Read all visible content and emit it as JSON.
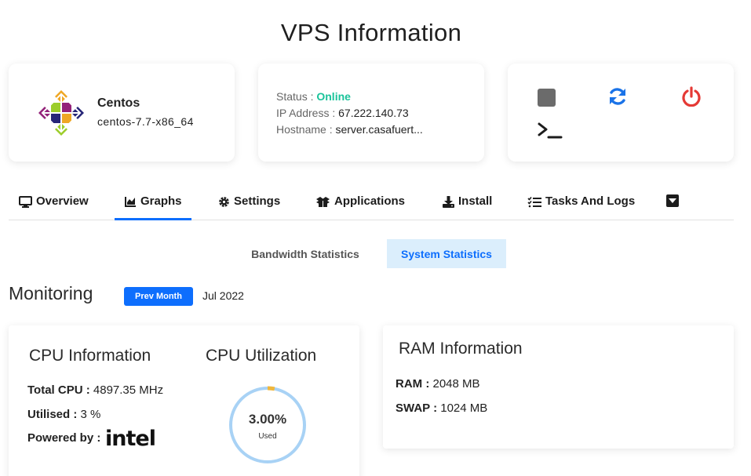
{
  "page": {
    "title": "VPS Information"
  },
  "os": {
    "name": "Centos",
    "version": "centos-7.7-x86_64",
    "logo_icon": "centos-logo-icon"
  },
  "status": {
    "status_label": "Status :",
    "status_value": "Online",
    "ip_label": "IP Address :",
    "ip_value": "67.222.140.73",
    "hostname_label": "Hostname :",
    "hostname_value": "server.casafuert..."
  },
  "actions": {
    "stop_icon": "stop-icon",
    "restart_icon": "refresh-icon",
    "power_icon": "power-icon",
    "console_icon": "terminal-icon"
  },
  "tabs": [
    {
      "label": "Overview",
      "icon": "monitor-icon"
    },
    {
      "label": "Graphs",
      "icon": "chart-area-icon"
    },
    {
      "label": "Settings",
      "icon": "gear-icon"
    },
    {
      "label": "Applications",
      "icon": "box-open-icon"
    },
    {
      "label": "Install",
      "icon": "download-icon"
    },
    {
      "label": "Tasks And Logs",
      "icon": "tasks-icon"
    }
  ],
  "more_icon": "caret-down-square-icon",
  "subtabs": {
    "bandwidth": "Bandwidth Statistics",
    "system": "System Statistics"
  },
  "monitoring": {
    "title": "Monitoring",
    "prev_button": "Prev Month",
    "month": "Jul 2022"
  },
  "cpu": {
    "title": "CPU Information",
    "total_label": "Total CPU :",
    "total_value": "4897.35 MHz",
    "utilised_label": "Utilised :",
    "utilised_value": "3 %",
    "powered_label": "Powered by :",
    "brand": "intel"
  },
  "cpu_util": {
    "title": "CPU Utilization",
    "value": "3.00%",
    "sub": "Used",
    "fraction": 0.03
  },
  "ram": {
    "title": "RAM Information",
    "ram_label": "RAM :",
    "ram_value": "2048 MB",
    "swap_label": "SWAP :",
    "swap_value": "1024 MB"
  },
  "colors": {
    "accent": "#0d6efd",
    "online": "#19c39a",
    "restart": "#1a73e8",
    "power": "#e53935",
    "gauge_ring": "#a8d2f5",
    "gauge_used": "#f0b73c"
  }
}
